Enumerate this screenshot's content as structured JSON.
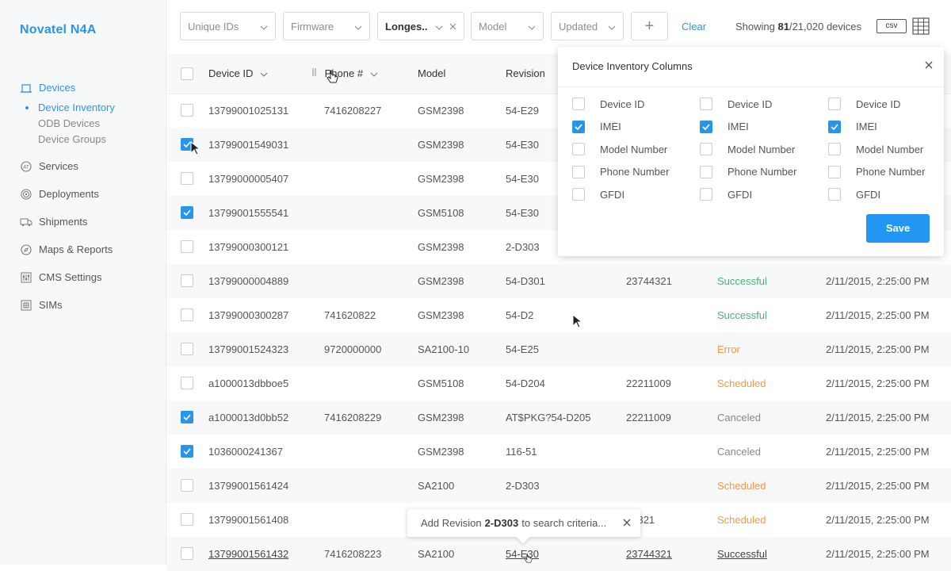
{
  "app": {
    "brand": "Novatel N4A"
  },
  "sidebar": {
    "items": [
      {
        "label": "Devices",
        "icon": "devices-icon",
        "active": true
      },
      {
        "label": "Services",
        "icon": "services-icon"
      },
      {
        "label": "Deployments",
        "icon": "deployments-icon"
      },
      {
        "label": "Shipments",
        "icon": "shipments-icon"
      },
      {
        "label": "Maps & Reports",
        "icon": "maps-icon"
      },
      {
        "label": "CMS Settings",
        "icon": "settings-icon"
      },
      {
        "label": "SIMs",
        "icon": "sim-icon"
      }
    ],
    "subitems": [
      {
        "label": "Device Inventory",
        "active": true
      },
      {
        "label": "ODB Devices"
      },
      {
        "label": "Device Groups"
      }
    ]
  },
  "toolbar": {
    "filters": [
      {
        "label": "Unique IDs"
      },
      {
        "label": "Firmware"
      },
      {
        "label": "Longes..",
        "applied": true
      },
      {
        "label": "Model"
      },
      {
        "label": "Updated"
      }
    ],
    "add_label": "+",
    "clear_label": "Clear",
    "showing_prefix": "Showing",
    "showing_count": "81",
    "showing_total": "/21,020 devices",
    "csv_label": "csv"
  },
  "table": {
    "headers": {
      "device_id": "Device ID",
      "phone": "Phone #",
      "model": "Model",
      "revision": "Revision"
    },
    "rows": [
      {
        "checked": false,
        "device_id": "13799001025131",
        "phone": "7416208227",
        "model": "GSM2398",
        "revision": "54-E29",
        "imei": "",
        "status": "",
        "updated": ""
      },
      {
        "checked": true,
        "device_id": "13799001549031",
        "phone": "",
        "model": "GSM2398",
        "revision": "54-E30",
        "imei": "",
        "status": "",
        "updated": ""
      },
      {
        "checked": false,
        "device_id": "13799000005407",
        "phone": "",
        "model": "GSM2398",
        "revision": "54-E30",
        "imei": "",
        "status": "",
        "updated": ""
      },
      {
        "checked": true,
        "device_id": "13799001555541",
        "phone": "",
        "model": "GSM5108",
        "revision": "54-E30",
        "imei": "",
        "status": "",
        "updated": ""
      },
      {
        "checked": false,
        "device_id": "13799000300121",
        "phone": "",
        "model": "GSM2398",
        "revision": "2-D303",
        "imei": "",
        "status": "",
        "updated": ""
      },
      {
        "checked": false,
        "device_id": "13799000004889",
        "phone": "",
        "model": "GSM2398",
        "revision": "54-D301",
        "imei": "23744321",
        "status": "Successful",
        "updated": "2/11/2015, 2:25:00 PM"
      },
      {
        "checked": false,
        "device_id": "13799000300287",
        "phone": "741620822",
        "model": "GSM2398",
        "revision": "54-D2",
        "imei": "",
        "status": "Successful",
        "updated": "2/11/2015, 2:25:00 PM"
      },
      {
        "checked": false,
        "device_id": "13799001524323",
        "phone": "9720000000",
        "model": "SA2100-10",
        "revision": "54-E25",
        "imei": "",
        "status": "Error",
        "updated": "2/11/2015, 2:25:00 PM"
      },
      {
        "checked": false,
        "device_id": "a1000013dbboe5",
        "phone": "",
        "model": "GSM5108",
        "revision": "54-D204",
        "imei": "22211009",
        "status": "Scheduled",
        "updated": "2/11/2015, 2:25:00 PM"
      },
      {
        "checked": true,
        "device_id": "a1000013d0bb52",
        "phone": "7416208229",
        "model": "GSM2398",
        "revision": "AT$PKG?54-D205",
        "imei": "22211009",
        "status": "Canceled",
        "updated": "2/11/2015, 2:25:00 PM"
      },
      {
        "checked": true,
        "device_id": "1036000241367",
        "phone": "",
        "model": "GSM2398",
        "revision": "116-51",
        "imei": "",
        "status": "Canceled",
        "updated": "2/11/2015, 2:25:00 PM"
      },
      {
        "checked": false,
        "device_id": "13799001561424",
        "phone": "",
        "model": "SA2100",
        "revision": "2-D303",
        "imei": "",
        "status": "Scheduled",
        "updated": "2/11/2015, 2:25:00 PM"
      },
      {
        "checked": false,
        "device_id": "13799001561408",
        "phone": "",
        "model": "",
        "revision": "",
        "imei": "44321",
        "status": "Scheduled",
        "updated": "2/11/2015, 2:25:00 PM"
      },
      {
        "checked": false,
        "device_id": "13799001561432",
        "phone": "7416208223",
        "model": "SA2100",
        "revision": "54-E30",
        "imei": "23744321",
        "status": "Successful",
        "updated": "2/11/2015, 2:25:00 PM",
        "hover": true
      }
    ]
  },
  "column_panel": {
    "title": "Device Inventory Columns",
    "columns": [
      [
        {
          "label": "Device ID",
          "checked": false
        },
        {
          "label": "IMEI",
          "checked": true
        },
        {
          "label": "Model Number",
          "checked": false
        },
        {
          "label": "Phone Number",
          "checked": false
        },
        {
          "label": "GFDI",
          "checked": false
        }
      ],
      [
        {
          "label": "Device ID",
          "checked": false
        },
        {
          "label": "IMEI",
          "checked": true
        },
        {
          "label": "Model Number",
          "checked": false
        },
        {
          "label": "Phone Number",
          "checked": false
        },
        {
          "label": "GFDI",
          "checked": false
        }
      ],
      [
        {
          "label": "Device ID",
          "checked": false
        },
        {
          "label": "IMEI",
          "checked": true
        },
        {
          "label": "Model Number",
          "checked": false
        },
        {
          "label": "Phone Number",
          "checked": false
        },
        {
          "label": "GFDI",
          "checked": false
        }
      ]
    ],
    "save_label": "Save"
  },
  "toast": {
    "prefix": "Add Revision",
    "value": "2-D303",
    "suffix": "to search criteria..."
  },
  "colors": {
    "accent": "#2a95e8",
    "success": "#4caf7d",
    "warning": "#f29a45",
    "muted": "#888888"
  }
}
